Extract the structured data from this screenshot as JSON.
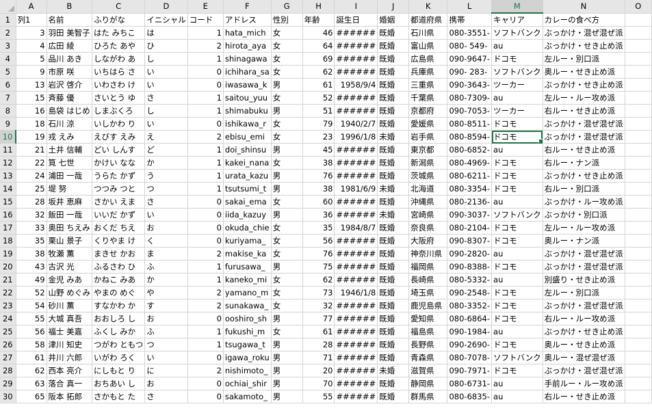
{
  "columns": [
    "A",
    "B",
    "C",
    "D",
    "E",
    "F",
    "G",
    "H",
    "I",
    "J",
    "K",
    "L",
    "M",
    "N",
    "O"
  ],
  "active_column": "M",
  "active_row": 10,
  "active_cell": {
    "row": 10,
    "col": "M"
  },
  "num_columns": [
    "A",
    "E",
    "H",
    "I"
  ],
  "rows": [
    {
      "n": "1",
      "A": "列1",
      "B": "名前",
      "C": "ふりがな",
      "D": "イニシャル",
      "E": "コード",
      "F": "アドレス",
      "G": "性別",
      "H": "年齢",
      "I": "誕生日",
      "J": "婚姻",
      "K": "都道府県",
      "L": "携帯",
      "M": "キャリア",
      "N": "カレーの食べ方",
      "O": ""
    },
    {
      "n": "2",
      "A": "3",
      "B": "羽田 美智子",
      "C": "はた みちこ",
      "D": "は",
      "E": "1",
      "F": "hata_mich",
      "G": "女",
      "H": "46",
      "I": "######",
      "J": "既婚",
      "K": "石川県",
      "L": "080-3551-",
      "M": "ソフトバンク",
      "N": "ぶっかけ・混ぜ混ぜ派",
      "O": ""
    },
    {
      "n": "3",
      "A": "4",
      "B": "広田 綾",
      "C": "ひろた あや",
      "D": "ひ",
      "E": "2",
      "F": "hirota_aya",
      "G": "女",
      "H": "64",
      "I": "######",
      "J": "既婚",
      "K": "富山県",
      "L": "080- 549-",
      "M": "au",
      "N": "ぶっかけ・せき止め派",
      "O": ""
    },
    {
      "n": "4",
      "A": "5",
      "B": "品川 あき",
      "C": "しながわ あ",
      "D": "し",
      "E": "1",
      "F": "shinagawa",
      "G": "女",
      "H": "69",
      "I": "######",
      "J": "既婚",
      "K": "広島県",
      "L": "090-9647-",
      "M": "ドコモ",
      "N": "左ルー・別口派",
      "O": ""
    },
    {
      "n": "5",
      "A": "9",
      "B": "市原 咲",
      "C": "いちはら さ",
      "D": "い",
      "E": "0",
      "F": "ichihara_sa",
      "G": "女",
      "H": "62",
      "I": "######",
      "J": "既婚",
      "K": "兵庫県",
      "L": "090- 283-",
      "M": "ソフトバンク",
      "N": "奥ルー・せき止め派",
      "O": ""
    },
    {
      "n": "6",
      "A": "13",
      "B": "岩沢 啓介",
      "C": "いわさわ け",
      "D": "い",
      "E": "0",
      "F": "iwasawa_k",
      "G": "男",
      "H": "61",
      "I": "1958/9/4",
      "J": "既婚",
      "K": "三重県",
      "L": "090-3643-",
      "M": "ツーカー",
      "N": "ぶっかけ・せき止め派",
      "O": ""
    },
    {
      "n": "7",
      "A": "15",
      "B": "斉藤 優",
      "C": "さいとう ゆ",
      "D": "さ",
      "E": "1",
      "F": "saitou_yuu",
      "G": "女",
      "H": "52",
      "I": "######",
      "J": "既婚",
      "K": "千葉県",
      "L": "080-7309-",
      "M": "au",
      "N": "左ルー・ルー攻め派",
      "O": ""
    },
    {
      "n": "8",
      "A": "16",
      "B": "島袋 はじめ",
      "C": "しまぶくろ",
      "D": "し",
      "E": "1",
      "F": "shimabuku",
      "G": "男",
      "H": "51",
      "I": "######",
      "J": "既婚",
      "K": "京都府",
      "L": "090-7053-",
      "M": "ツーカー",
      "N": "右ルー・せき止め派",
      "O": ""
    },
    {
      "n": "9",
      "A": "18",
      "B": "石川 涼",
      "C": "いしかわ り",
      "D": "い",
      "E": "0",
      "F": "ishikawa_r",
      "G": "女",
      "H": "79",
      "I": "1940/2/7",
      "J": "既婚",
      "K": "愛媛県",
      "L": "080-8511-",
      "M": "ドコモ",
      "N": "ぶっかけ・混ぜ混ぜ派",
      "O": ""
    },
    {
      "n": "10",
      "A": "19",
      "B": "戎 えみ",
      "C": "えびす えみ",
      "D": "え",
      "E": "2",
      "F": "ebisu_emi",
      "G": "女",
      "H": "23",
      "I": "1996/1/8",
      "J": "未婚",
      "K": "岩手県",
      "L": "080-8594-",
      "M": "ドコモ",
      "N": "ぶっかけ・混ぜ混ぜ派",
      "O": ""
    },
    {
      "n": "11",
      "A": "21",
      "B": "土井 信輔",
      "C": "どい しんす",
      "D": "ど",
      "E": "1",
      "F": "doi_shinsu",
      "G": "男",
      "H": "45",
      "I": "######",
      "J": "既婚",
      "K": "東京都",
      "L": "080-6852-",
      "M": "au",
      "N": "右ルー・せき止め派",
      "O": ""
    },
    {
      "n": "12",
      "A": "22",
      "B": "筧 七世",
      "C": "かけい なな",
      "D": "か",
      "E": "1",
      "F": "kakei_nana",
      "G": "女",
      "H": "38",
      "I": "######",
      "J": "既婚",
      "K": "新潟県",
      "L": "080-4969-",
      "M": "ドコモ",
      "N": "右ルー・ナン派",
      "O": ""
    },
    {
      "n": "13",
      "A": "24",
      "B": "浦田 一哉",
      "C": "うらた かず",
      "D": "う",
      "E": "1",
      "F": "urata_kazu",
      "G": "男",
      "H": "76",
      "I": "######",
      "J": "既婚",
      "K": "茨城県",
      "L": "080-6211-",
      "M": "ドコモ",
      "N": "ぶっかけ・せき止め派",
      "O": ""
    },
    {
      "n": "14",
      "A": "25",
      "B": "堤 努",
      "C": "つつみ つと",
      "D": "つ",
      "E": "1",
      "F": "tsutsumi_t",
      "G": "男",
      "H": "38",
      "I": "1981/6/9",
      "J": "未婚",
      "K": "北海道",
      "L": "080-3354-",
      "M": "ドコモ",
      "N": "右ルー・別口派",
      "O": ""
    },
    {
      "n": "15",
      "A": "28",
      "B": "坂井 恵麻",
      "C": "さかい えま",
      "D": "さ",
      "E": "0",
      "F": "sakai_ema",
      "G": "女",
      "H": "60",
      "I": "######",
      "J": "既婚",
      "K": "沖縄県",
      "L": "080-2136-",
      "M": "au",
      "N": "ぶっかけ・ルー攻め派",
      "O": ""
    },
    {
      "n": "16",
      "A": "32",
      "B": "飯田 一哉",
      "C": "いいだ かず",
      "D": "い",
      "E": "0",
      "F": "iida_kazuy",
      "G": "男",
      "H": "36",
      "I": "######",
      "J": "未婚",
      "K": "宮崎県",
      "L": "090-3037-",
      "M": "ソフトバンク",
      "N": "ぶっかけ・別口派",
      "O": ""
    },
    {
      "n": "17",
      "A": "33",
      "B": "奥田 ちえみ",
      "C": "おくだ ちえ",
      "D": "お",
      "E": "0",
      "F": "okuda_chie",
      "G": "女",
      "H": "35",
      "I": "1984/8/7",
      "J": "既婚",
      "K": "奈良県",
      "L": "080-2104-",
      "M": "ドコモ",
      "N": "左ルー・ルー攻め派",
      "O": ""
    },
    {
      "n": "18",
      "A": "35",
      "B": "栗山 景子",
      "C": "くりやま け",
      "D": "く",
      "E": "0",
      "F": "kuriyama_",
      "G": "女",
      "H": "56",
      "I": "######",
      "J": "既婚",
      "K": "大阪府",
      "L": "090-8307-",
      "M": "ドコモ",
      "N": "奥ルー・ナン派",
      "O": ""
    },
    {
      "n": "19",
      "A": "38",
      "B": "牧瀬 薫",
      "C": "まきせ かお",
      "D": "ま",
      "E": "2",
      "F": "makise_ka",
      "G": "女",
      "H": "76",
      "I": "######",
      "J": "既婚",
      "K": "神奈川県",
      "L": "090-2820-",
      "M": "au",
      "N": "ぶっかけ・混ぜ混ぜ派",
      "O": ""
    },
    {
      "n": "20",
      "A": "43",
      "B": "古沢 光",
      "C": "ふるさわ ひ",
      "D": "ふ",
      "E": "1",
      "F": "furusawa_",
      "G": "男",
      "H": "75",
      "I": "######",
      "J": "既婚",
      "K": "福岡県",
      "L": "090-8388-",
      "M": "ドコモ",
      "N": "ぶっかけ・混ぜ混ぜ派",
      "O": ""
    },
    {
      "n": "21",
      "A": "49",
      "B": "金児 みあ",
      "C": "かねこ みあ",
      "D": "か",
      "E": "1",
      "F": "kaneko_mi",
      "G": "女",
      "H": "62",
      "I": "######",
      "J": "既婚",
      "K": "長崎県",
      "L": "080-5332-",
      "M": "au",
      "N": "別盛り・せき止め派",
      "O": ""
    },
    {
      "n": "22",
      "A": "52",
      "B": "山野 めぐみ",
      "C": "やまの めぐ",
      "D": "や",
      "E": "2",
      "F": "yamano_m",
      "G": "女",
      "H": "73",
      "I": "1946/1/8",
      "J": "既婚",
      "K": "埼玉県",
      "L": "090-2548-",
      "M": "ドコモ",
      "N": "左ルー・別口派",
      "O": ""
    },
    {
      "n": "23",
      "A": "54",
      "B": "砂川 薫",
      "C": "すなかわ か",
      "D": "す",
      "E": "2",
      "F": "sunakawa_",
      "G": "女",
      "H": "32",
      "I": "######",
      "J": "既婚",
      "K": "鹿児島県",
      "L": "080-3352-",
      "M": "ドコモ",
      "N": "ぶっかけ・混ぜ混ぜ派",
      "O": ""
    },
    {
      "n": "24",
      "A": "55",
      "B": "大城 真吾",
      "C": "おおしろ し",
      "D": "お",
      "E": "0",
      "F": "ooshiro_sh",
      "G": "男",
      "H": "77",
      "I": "######",
      "J": "既婚",
      "K": "愛知県",
      "L": "080-6864-",
      "M": "ドコモ",
      "N": "右ルー・ルー攻め派",
      "O": ""
    },
    {
      "n": "25",
      "A": "56",
      "B": "福士 美嘉",
      "C": "ふくし みか",
      "D": "ふ",
      "E": "1",
      "F": "fukushi_m",
      "G": "女",
      "H": "61",
      "I": "######",
      "J": "既婚",
      "K": "福島県",
      "L": "090-1984-",
      "M": "au",
      "N": "ぶっかけ・せき止め派",
      "O": ""
    },
    {
      "n": "26",
      "A": "58",
      "B": "津川 知史",
      "C": "つがわ ともつ",
      "D": "つ",
      "E": "1",
      "F": "tsugawa_t",
      "G": "男",
      "H": "28",
      "I": "######",
      "J": "既婚",
      "K": "長野県",
      "L": "090-2690-",
      "M": "ドコモ",
      "N": "奥ルー・せき止め派",
      "O": ""
    },
    {
      "n": "27",
      "A": "61",
      "B": "井川 六郎",
      "C": "いがわ ろく",
      "D": "い",
      "E": "0",
      "F": "igawa_roku",
      "G": "男",
      "H": "71",
      "I": "######",
      "J": "既婚",
      "K": "青森県",
      "L": "080-7078-",
      "M": "ソフトバンク",
      "N": "奥ルー・混ぜ混ぜ派",
      "O": ""
    },
    {
      "n": "28",
      "A": "62",
      "B": "西本 亮介",
      "C": "にしもと り",
      "D": "に",
      "E": "2",
      "F": "nishimoto_",
      "G": "男",
      "H": "20",
      "I": "######",
      "J": "未婚",
      "K": "滋賀県",
      "L": "090-7971-",
      "M": "ドコモ",
      "N": "ぶっかけ・混ぜ混ぜ派",
      "O": ""
    },
    {
      "n": "29",
      "A": "63",
      "B": "落合 真一",
      "C": "おちあい し",
      "D": "お",
      "E": "0",
      "F": "ochiai_shir",
      "G": "男",
      "H": "70",
      "I": "######",
      "J": "既婚",
      "K": "静岡県",
      "L": "080-6731-",
      "M": "au",
      "N": "手前ルー・ルー攻め派",
      "O": ""
    },
    {
      "n": "30",
      "A": "65",
      "B": "阪本 拓郎",
      "C": "さかもと た",
      "D": "さ",
      "E": "0",
      "F": "sakamoto_",
      "G": "男",
      "H": "55",
      "I": "######",
      "J": "既婚",
      "K": "群馬県",
      "L": "080-6835-",
      "M": "au",
      "N": "右ルー・せき止め派",
      "O": ""
    }
  ]
}
